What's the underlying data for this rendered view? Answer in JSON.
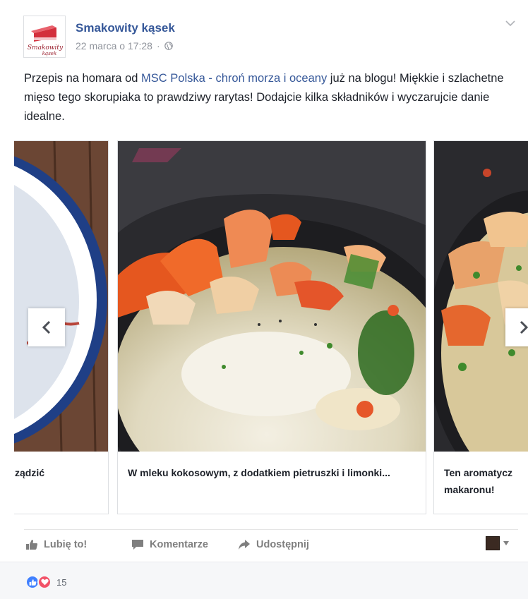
{
  "post": {
    "page_name": "Smakowity kąsek",
    "timestamp": "22 marca o 17:28",
    "meta_separator": "·",
    "logo_text": "Smakowity kąsek",
    "text": {
      "part1": "Przepis na homara od ",
      "link": "MSC Polska - chroń morza i oceany",
      "part2": " już na blogu! Miękkie i szlachetne mięso tego skorupiaka to prawdziwy rarytas! Dodajcie kilka składników i wyczarujcie danie idealne."
    }
  },
  "carousel": {
    "cards": [
      {
        "caption": "ządzić"
      },
      {
        "caption": "W mleku kokosowym, z dodatkiem pietruszki i limonki..."
      },
      {
        "caption": "Ten aromatycz makaronu!"
      }
    ],
    "prev_icon": "chevron-left-icon",
    "next_icon": "chevron-right-icon"
  },
  "actions": {
    "like": "Lubię to!",
    "comment": "Komentarze",
    "share": "Udostępnij"
  },
  "reactions": {
    "types": [
      "like-icon",
      "love-icon"
    ],
    "count": "15"
  },
  "colors": {
    "link": "#365899",
    "like_reaction": "#4080ff",
    "love_reaction": "#f25268",
    "meta": "#90949c"
  }
}
